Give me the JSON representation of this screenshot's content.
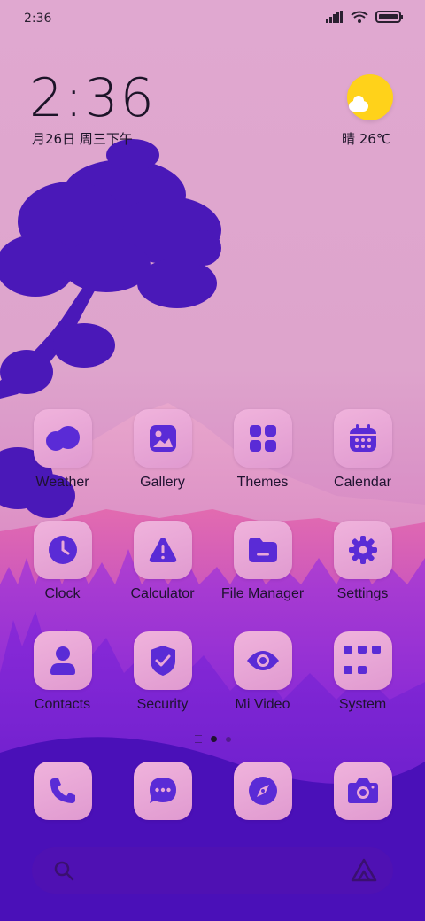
{
  "status_bar": {
    "time": "2:36"
  },
  "lockclock": {
    "time": "2:36",
    "date": "月26日 周三下午"
  },
  "weather": {
    "text": "晴 26℃"
  },
  "colors": {
    "accent": "#5a2bd6",
    "tile": "#e9a8d8",
    "sun": "#ffd21a"
  },
  "apps": [
    {
      "label": "Weather",
      "icon": "weather-icon"
    },
    {
      "label": "Gallery",
      "icon": "gallery-icon"
    },
    {
      "label": "Themes",
      "icon": "themes-icon"
    },
    {
      "label": "Calendar",
      "icon": "calendar-icon"
    },
    {
      "label": "Clock",
      "icon": "clock-icon"
    },
    {
      "label": "Calculator",
      "icon": "calculator-icon"
    },
    {
      "label": "File Manager",
      "icon": "folder-icon"
    },
    {
      "label": "Settings",
      "icon": "gear-icon"
    },
    {
      "label": "Contacts",
      "icon": "contacts-icon"
    },
    {
      "label": "Security",
      "icon": "shield-icon"
    },
    {
      "label": "Mi Video",
      "icon": "eye-icon"
    },
    {
      "label": "System",
      "icon": "folder-grid-icon"
    }
  ],
  "dock": [
    {
      "icon": "phone-icon"
    },
    {
      "icon": "message-icon"
    },
    {
      "icon": "compass-icon"
    },
    {
      "icon": "camera-icon"
    }
  ],
  "page_indicator": {
    "pages": 2,
    "current": 1
  }
}
